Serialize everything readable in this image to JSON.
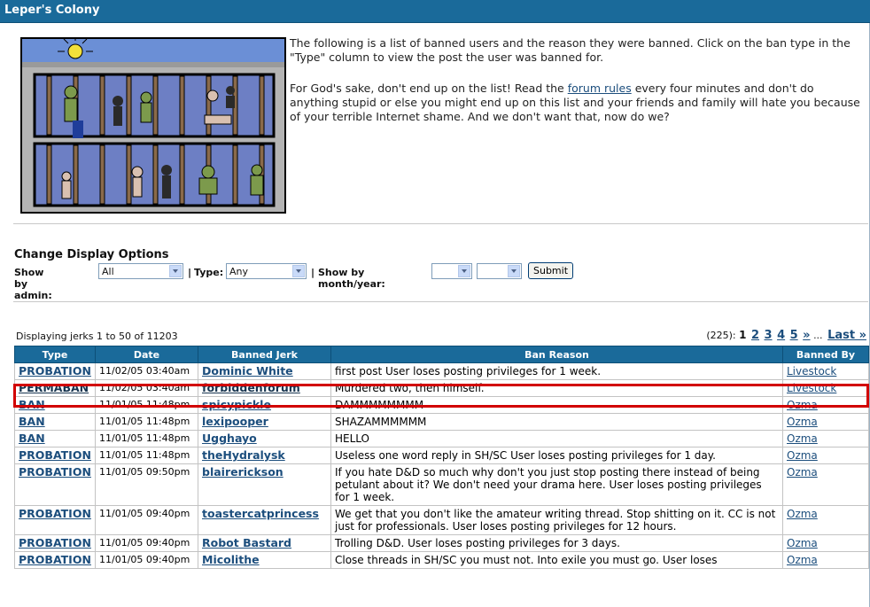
{
  "window": {
    "title": "Leper's Colony"
  },
  "intro": {
    "p1": "The following is a list of banned users and the reason they were banned. Click on the ban type in the \"Type\" column to view the post the user was banned for.",
    "p2_before": "For God's sake, don't end up on the list! Read the ",
    "p2_link": "forum rules",
    "p2_after": " every four minutes and don't do anything stupid or else you might end up on this list and your friends and family will hate you because of your terrible Internet shame. And we don't want that, now do we?"
  },
  "options": {
    "title": "Change Display Options",
    "admin_label": "Show by admin:",
    "admin_value": "All",
    "type_label": "Type:",
    "type_value": "Any",
    "month_label": "Show by month/year:",
    "month_value": "",
    "year_value": "",
    "submit_label": "Submit"
  },
  "listing": {
    "showing": "Displaying jerks 1 to 50 of 11203",
    "pager": {
      "total": "(225):",
      "current": "1",
      "pages": [
        "2",
        "3",
        "4",
        "5"
      ],
      "next": "»",
      "ellipsis": "...",
      "last": "Last »"
    },
    "columns": [
      "Type",
      "Date",
      "Banned Jerk",
      "Ban Reason",
      "Banned By"
    ],
    "rows": [
      {
        "type": "PROBATION",
        "date": "11/02/05 03:40am",
        "jerk": "Dominic White",
        "reason": "first post User loses posting privileges for 1 week.",
        "by": "Livestock"
      },
      {
        "type": "PERMABAN",
        "date": "11/02/05 03:40am",
        "jerk": "forbiddenforum",
        "reason": "Murdered two, then himself.",
        "by": "Livestock"
      },
      {
        "type": "BAN",
        "date": "11/01/05 11:48pm",
        "jerk": "spicypickle",
        "reason": "DAMMMMMMMM",
        "by": "Ozma"
      },
      {
        "type": "BAN",
        "date": "11/01/05 11:48pm",
        "jerk": "lexipooper",
        "reason": "SHAZAMMMMMM",
        "by": "Ozma"
      },
      {
        "type": "BAN",
        "date": "11/01/05 11:48pm",
        "jerk": "Ugghayo",
        "reason": "HELLO",
        "by": "Ozma"
      },
      {
        "type": "PROBATION",
        "date": "11/01/05 11:48pm",
        "jerk": "theHydralysk",
        "reason": "Useless one word reply in SH/SC User loses posting privileges for 1 day.",
        "by": "Ozma"
      },
      {
        "type": "PROBATION",
        "date": "11/01/05 09:50pm",
        "jerk": "blairerickson",
        "reason": "If you hate D&D so much why don't you just stop posting there instead of being petulant about it? We don't need your drama here. User loses posting privileges for 1 week.",
        "by": "Ozma"
      },
      {
        "type": "PROBATION",
        "date": "11/01/05 09:40pm",
        "jerk": "toastercatprincess",
        "reason": "We get that you don't like the amateur writing thread. Stop shitting on it. CC is not just for professionals. User loses posting privileges for 12 hours.",
        "by": "Ozma"
      },
      {
        "type": "PROBATION",
        "date": "11/01/05 09:40pm",
        "jerk": "Robot Bastard",
        "reason": "Trolling D&D. User loses posting privileges for 3 days.",
        "by": "Ozma"
      },
      {
        "type": "PROBATION",
        "date": "11/01/05 09:40pm",
        "jerk": "Micolithe",
        "reason": "Close threads in SH/SC you must not. Into exile you must go. User loses",
        "by": "Ozma"
      }
    ]
  },
  "colors": {
    "header_bg": "#1a6a9a",
    "link": "#1c4e7d",
    "highlight": "#d20000"
  },
  "icons": {
    "dropdown": "chevron-down-icon"
  }
}
